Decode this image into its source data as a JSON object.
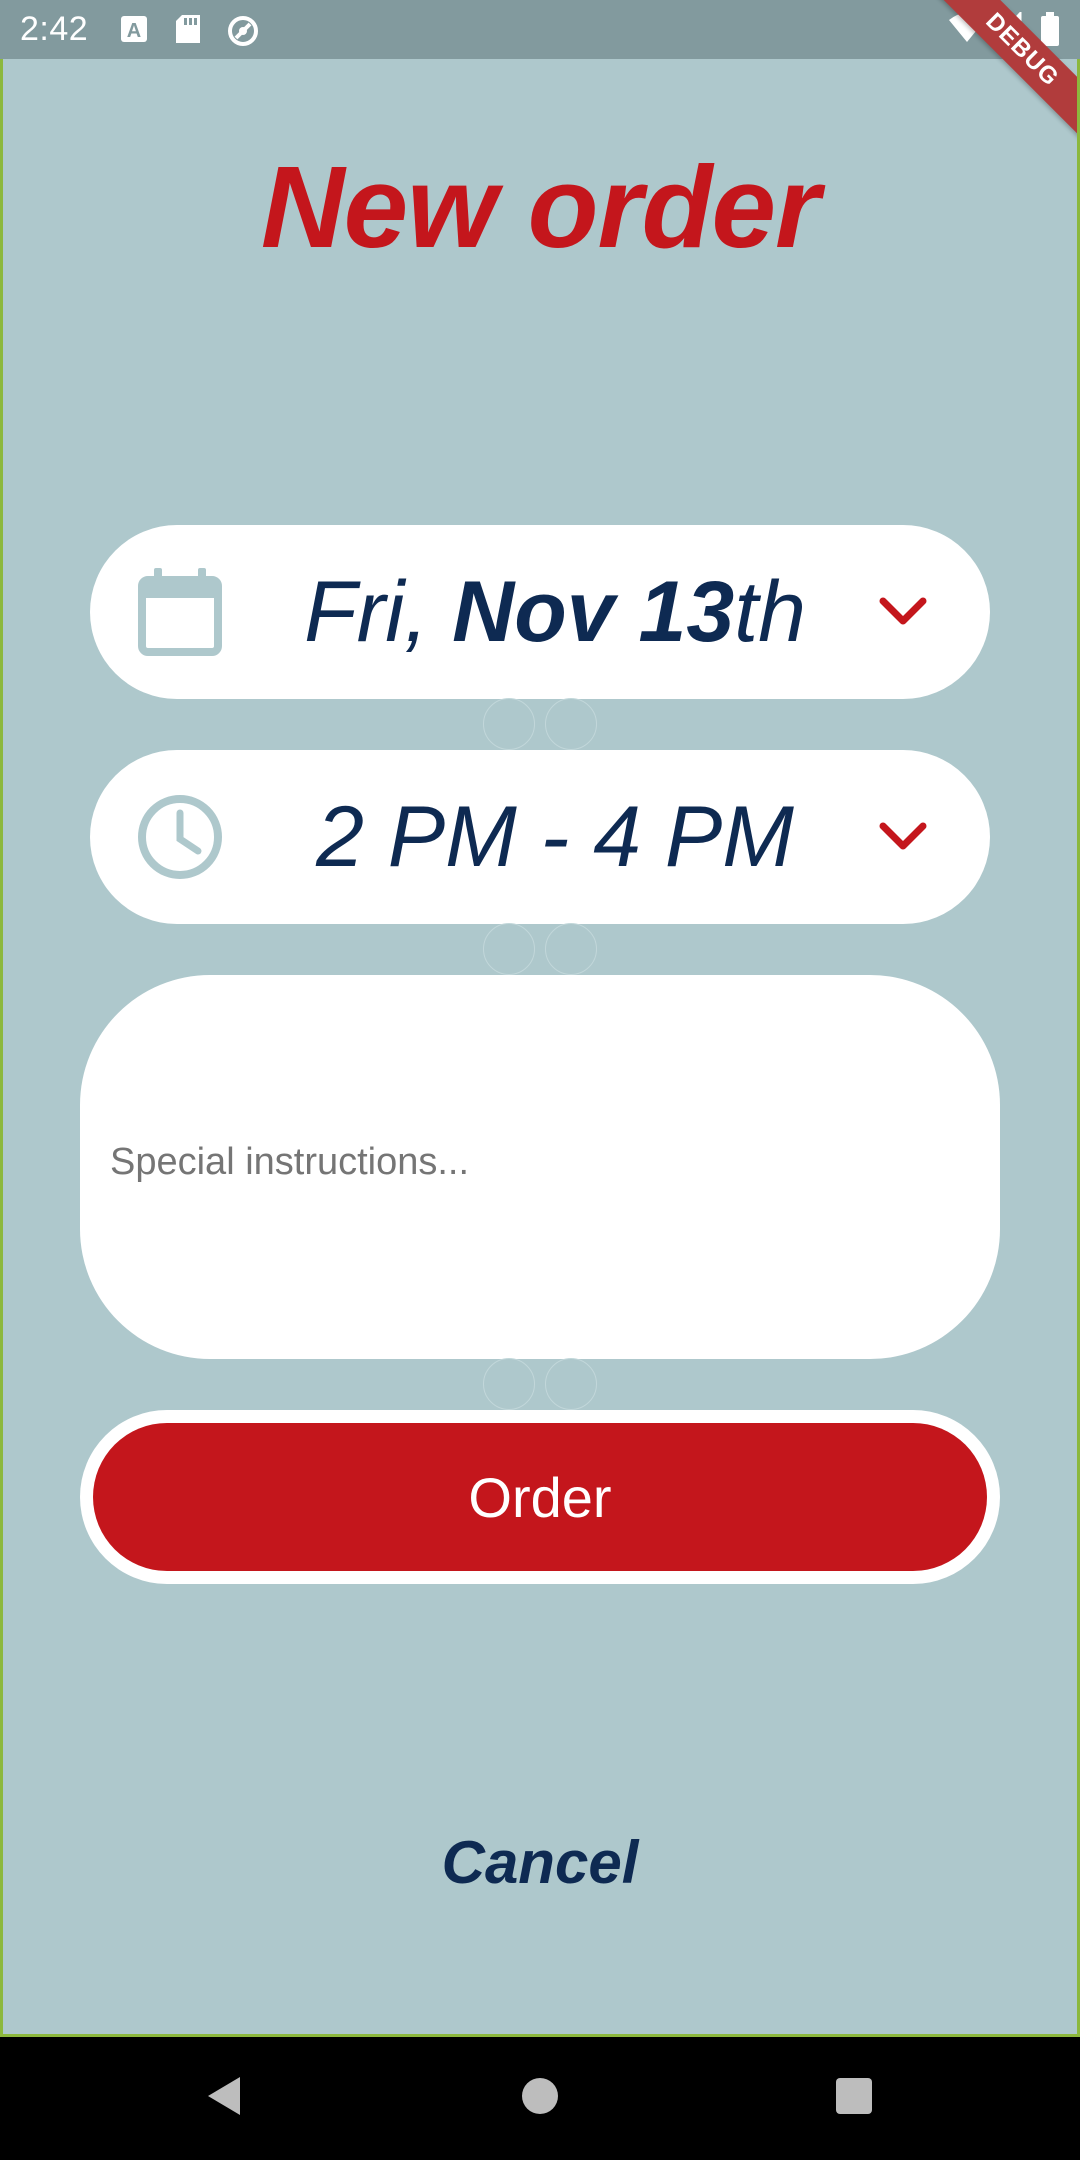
{
  "status_bar": {
    "time": "2:42",
    "icons": [
      "a-notification-icon",
      "sd-card-icon",
      "sync-icon",
      "wifi-icon",
      "signal-icon",
      "battery-icon"
    ],
    "debug_label": "DEBUG"
  },
  "header": {
    "title": "New order"
  },
  "date_picker": {
    "day": "Fri,",
    "month_day": "Nov 13",
    "suffix": "th",
    "icon": "calendar-icon"
  },
  "time_picker": {
    "value": "2 PM - 4 PM",
    "icon": "clock-icon"
  },
  "instructions": {
    "placeholder": "Special instructions...",
    "value": ""
  },
  "actions": {
    "order_label": "Order",
    "cancel_label": "Cancel"
  },
  "nav_bar": {
    "icons": [
      "back-icon",
      "home-icon",
      "recents-icon"
    ]
  },
  "colors": {
    "background": "#aec8cc",
    "accent_red": "#c4161c",
    "navy": "#0e2a52",
    "icon_grey": "#aec8cc"
  }
}
